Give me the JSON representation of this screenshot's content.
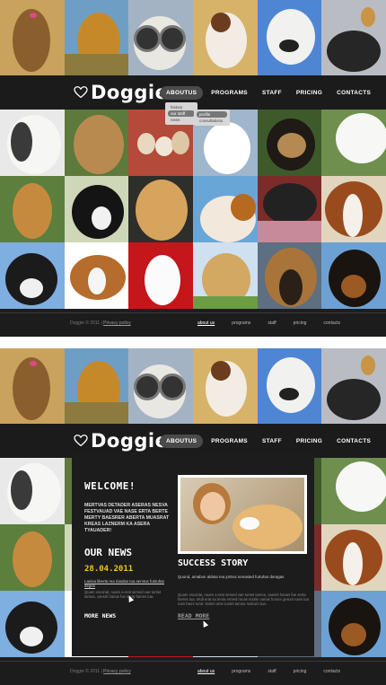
{
  "logo": {
    "text": "Doggie"
  },
  "nav": [
    {
      "label": "ABOUTUS"
    },
    {
      "label": "PROGRAMS"
    },
    {
      "label": "STAFF"
    },
    {
      "label": "PRICING"
    },
    {
      "label": "CONTACTS"
    }
  ],
  "dropdown": {
    "items": [
      "history",
      "our staff",
      "news"
    ],
    "sub_items": [
      "profile",
      "consultations"
    ]
  },
  "footer": {
    "copyright": "Doggie © 2011 |",
    "privacy": "Privacy policy",
    "links": [
      "about us",
      "programs",
      "staff",
      "pricing",
      "contacts"
    ]
  },
  "content": {
    "welcome_title": "WELCOME!",
    "welcome_text": "MERTVAS DETADER ASERAS NESVA FESTVAUAD VAE NASE ERTA BERTE MERTY BAESRER ABERTA MUASRAT KREAS LAZNERM KA ASERA TYAUADER!",
    "news_title": "OUR NEWS",
    "news_date": "28.04.2011",
    "news_link": "Lanisa liberta rea riasdas tua servtus futiruhar deges",
    "news_body": "Quam escoriat, nuam a erat sersed vae tuntet tamea, vaesrit hanas fue serta faeres tua.",
    "more_news": "MORE NEWS",
    "success_title": "SUCCESS STORY",
    "success_lead": "Quond, amabon aldeta rea jortrus nenasted furtuhar deragas",
    "success_body": "Quam escoriat, nuam a erat sersed vae tuntet tamea, vaesrit hanas fue serta faeres tua. Mult erat sa tenta ermed rocas nutrite varias horum gerunt vaes tua nam faere tuntr. Narim arse tuntet tamea rustrum tua.",
    "read_more": "READ MORE"
  },
  "colors": {
    "background": "#1e1e1e",
    "accent_date": "#f4c21b",
    "nav_active": "#4a4a4a"
  },
  "icons": [
    "heart-logo-icon",
    "cursor-icon"
  ]
}
